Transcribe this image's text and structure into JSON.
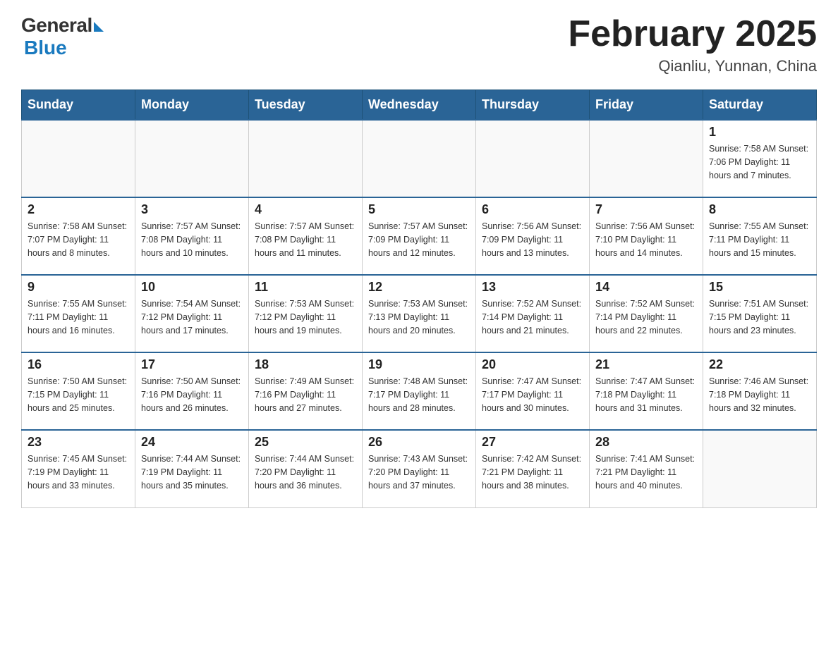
{
  "header": {
    "logo_general": "General",
    "logo_blue": "Blue",
    "month_title": "February 2025",
    "location": "Qianliu, Yunnan, China"
  },
  "days_of_week": [
    "Sunday",
    "Monday",
    "Tuesday",
    "Wednesday",
    "Thursday",
    "Friday",
    "Saturday"
  ],
  "weeks": [
    [
      {
        "day": "",
        "info": ""
      },
      {
        "day": "",
        "info": ""
      },
      {
        "day": "",
        "info": ""
      },
      {
        "day": "",
        "info": ""
      },
      {
        "day": "",
        "info": ""
      },
      {
        "day": "",
        "info": ""
      },
      {
        "day": "1",
        "info": "Sunrise: 7:58 AM\nSunset: 7:06 PM\nDaylight: 11 hours\nand 7 minutes."
      }
    ],
    [
      {
        "day": "2",
        "info": "Sunrise: 7:58 AM\nSunset: 7:07 PM\nDaylight: 11 hours\nand 8 minutes."
      },
      {
        "day": "3",
        "info": "Sunrise: 7:57 AM\nSunset: 7:08 PM\nDaylight: 11 hours\nand 10 minutes."
      },
      {
        "day": "4",
        "info": "Sunrise: 7:57 AM\nSunset: 7:08 PM\nDaylight: 11 hours\nand 11 minutes."
      },
      {
        "day": "5",
        "info": "Sunrise: 7:57 AM\nSunset: 7:09 PM\nDaylight: 11 hours\nand 12 minutes."
      },
      {
        "day": "6",
        "info": "Sunrise: 7:56 AM\nSunset: 7:09 PM\nDaylight: 11 hours\nand 13 minutes."
      },
      {
        "day": "7",
        "info": "Sunrise: 7:56 AM\nSunset: 7:10 PM\nDaylight: 11 hours\nand 14 minutes."
      },
      {
        "day": "8",
        "info": "Sunrise: 7:55 AM\nSunset: 7:11 PM\nDaylight: 11 hours\nand 15 minutes."
      }
    ],
    [
      {
        "day": "9",
        "info": "Sunrise: 7:55 AM\nSunset: 7:11 PM\nDaylight: 11 hours\nand 16 minutes."
      },
      {
        "day": "10",
        "info": "Sunrise: 7:54 AM\nSunset: 7:12 PM\nDaylight: 11 hours\nand 17 minutes."
      },
      {
        "day": "11",
        "info": "Sunrise: 7:53 AM\nSunset: 7:12 PM\nDaylight: 11 hours\nand 19 minutes."
      },
      {
        "day": "12",
        "info": "Sunrise: 7:53 AM\nSunset: 7:13 PM\nDaylight: 11 hours\nand 20 minutes."
      },
      {
        "day": "13",
        "info": "Sunrise: 7:52 AM\nSunset: 7:14 PM\nDaylight: 11 hours\nand 21 minutes."
      },
      {
        "day": "14",
        "info": "Sunrise: 7:52 AM\nSunset: 7:14 PM\nDaylight: 11 hours\nand 22 minutes."
      },
      {
        "day": "15",
        "info": "Sunrise: 7:51 AM\nSunset: 7:15 PM\nDaylight: 11 hours\nand 23 minutes."
      }
    ],
    [
      {
        "day": "16",
        "info": "Sunrise: 7:50 AM\nSunset: 7:15 PM\nDaylight: 11 hours\nand 25 minutes."
      },
      {
        "day": "17",
        "info": "Sunrise: 7:50 AM\nSunset: 7:16 PM\nDaylight: 11 hours\nand 26 minutes."
      },
      {
        "day": "18",
        "info": "Sunrise: 7:49 AM\nSunset: 7:16 PM\nDaylight: 11 hours\nand 27 minutes."
      },
      {
        "day": "19",
        "info": "Sunrise: 7:48 AM\nSunset: 7:17 PM\nDaylight: 11 hours\nand 28 minutes."
      },
      {
        "day": "20",
        "info": "Sunrise: 7:47 AM\nSunset: 7:17 PM\nDaylight: 11 hours\nand 30 minutes."
      },
      {
        "day": "21",
        "info": "Sunrise: 7:47 AM\nSunset: 7:18 PM\nDaylight: 11 hours\nand 31 minutes."
      },
      {
        "day": "22",
        "info": "Sunrise: 7:46 AM\nSunset: 7:18 PM\nDaylight: 11 hours\nand 32 minutes."
      }
    ],
    [
      {
        "day": "23",
        "info": "Sunrise: 7:45 AM\nSunset: 7:19 PM\nDaylight: 11 hours\nand 33 minutes."
      },
      {
        "day": "24",
        "info": "Sunrise: 7:44 AM\nSunset: 7:19 PM\nDaylight: 11 hours\nand 35 minutes."
      },
      {
        "day": "25",
        "info": "Sunrise: 7:44 AM\nSunset: 7:20 PM\nDaylight: 11 hours\nand 36 minutes."
      },
      {
        "day": "26",
        "info": "Sunrise: 7:43 AM\nSunset: 7:20 PM\nDaylight: 11 hours\nand 37 minutes."
      },
      {
        "day": "27",
        "info": "Sunrise: 7:42 AM\nSunset: 7:21 PM\nDaylight: 11 hours\nand 38 minutes."
      },
      {
        "day": "28",
        "info": "Sunrise: 7:41 AM\nSunset: 7:21 PM\nDaylight: 11 hours\nand 40 minutes."
      },
      {
        "day": "",
        "info": ""
      }
    ]
  ]
}
